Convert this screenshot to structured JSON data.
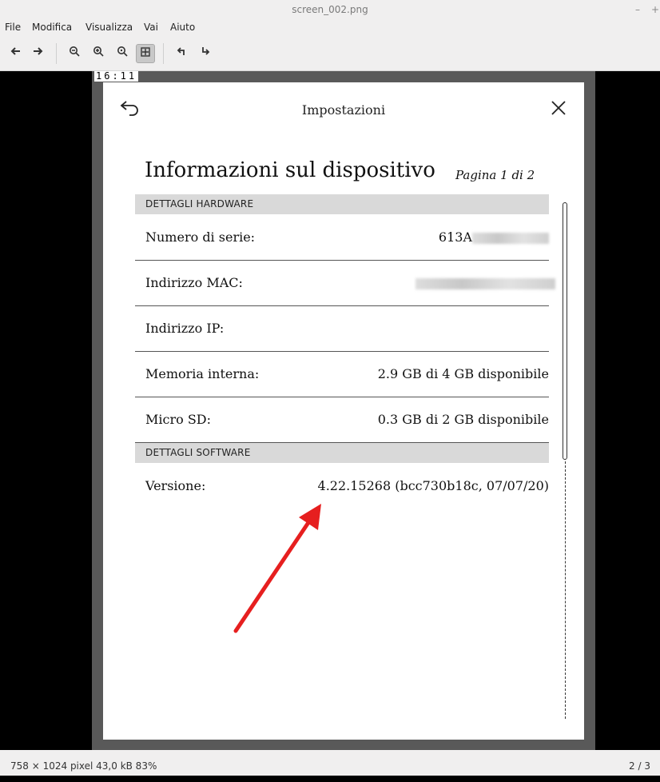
{
  "window": {
    "title": "screen_002.png"
  },
  "menu": {
    "items": [
      "File",
      "Modifica",
      "Visualizza",
      "Vai",
      "Aiuto"
    ]
  },
  "toolbar": {
    "buttons": [
      "back-arrow-icon",
      "forward-arrow-icon",
      "zoom-out-icon",
      "zoom-in-icon",
      "zoom-fit-icon",
      "best-fit-icon",
      "rotate-left-icon",
      "rotate-right-icon"
    ]
  },
  "device": {
    "clock": "16:11",
    "title": "Impostazioni",
    "heading": "Informazioni sul dispositivo",
    "page_indicator": "Pagina 1 di 2",
    "hardware_header": "DETTAGLI HARDWARE",
    "rows": [
      {
        "label": "Numero di serie:",
        "value": "613A"
      },
      {
        "label": "Indirizzo MAC:",
        "value": ""
      },
      {
        "label": "Indirizzo IP:",
        "value": ""
      },
      {
        "label": "Memoria interna:",
        "value": "2.9 GB di 4 GB disponibile"
      },
      {
        "label": "Micro SD:",
        "value": "0.3 GB di 2 GB disponibile"
      }
    ],
    "software_header": "DETTAGLI SOFTWARE",
    "version": {
      "label": "Versione:",
      "value": "4.22.15268 (bcc730b18c, 07/07/20)"
    }
  },
  "statusbar": {
    "info": "758 × 1024 pixel  43,0 kB   83%",
    "page": "2 / 3"
  },
  "colors": {
    "annotation_arrow": "#e61f1f",
    "section_header_bg": "#d9d9d9"
  }
}
